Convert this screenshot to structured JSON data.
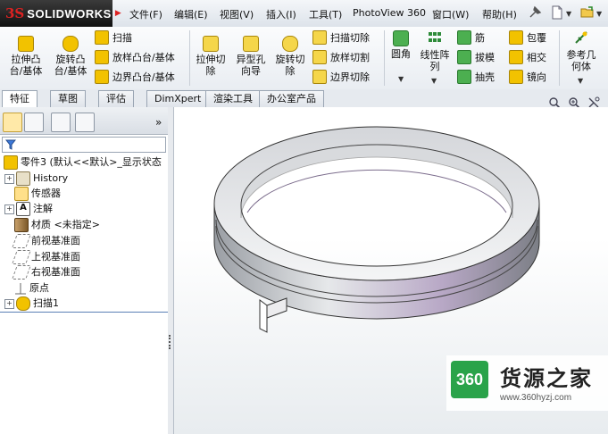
{
  "titlebar": {
    "brand_prefix": "3S",
    "brand_name": "SOLIDWORKS",
    "menus": [
      "文件(F)",
      "编辑(E)",
      "视图(V)",
      "插入(I)",
      "工具(T)",
      "PhotoView 360",
      "窗口(W)",
      "帮助(H)"
    ]
  },
  "ribbon": {
    "extrude_boss": "拉伸凸\n台/基体",
    "revolve_boss": "旋转凸\n台/基体",
    "sweep": "扫描",
    "loft_boss": "放样凸台/基体",
    "boundary_boss": "边界凸台/基体",
    "extrude_cut": "拉伸切\n除",
    "hole_wizard": "异型孔\n向导",
    "revolve_cut": "旋转切\n除",
    "swept_cut": "扫描切除",
    "lofted_cut": "放样切割",
    "boundary_cut": "边界切除",
    "fillet": "圆角",
    "linear_pattern": "线性阵\n列",
    "rib": "筋",
    "draft": "拔模",
    "shell": "抽壳",
    "wrap": "包覆",
    "intersect": "相交",
    "mirror": "镜向",
    "ref_geometry": "参考几\n何体"
  },
  "tabs": [
    "特征",
    "草图",
    "评估",
    "DimXpert",
    "渲染工具",
    "办公室产品"
  ],
  "tree": {
    "root": "零件3  (默认<<默认>_显示状态",
    "items": [
      "History",
      "传感器",
      "注解",
      "材质 <未指定>",
      "前视基准面",
      "上视基准面",
      "右视基准面",
      "原点",
      "扫描1"
    ]
  },
  "watermark": {
    "badge": "360",
    "title": "货源之家",
    "url": "www.360hyzj.com"
  },
  "colors": {
    "accent": "#2aa34a",
    "feature_yellow": "#f2c200",
    "ring_purple": "#b49cc4"
  }
}
